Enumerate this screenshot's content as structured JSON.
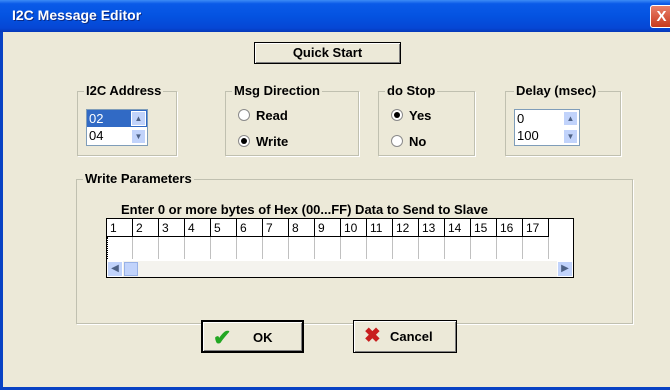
{
  "window": {
    "title": "I2C Message Editor",
    "close_glyph": "X"
  },
  "quick_start_label": "Quick Start",
  "i2c_address": {
    "legend": "I2C Address",
    "items": [
      "02",
      "04"
    ]
  },
  "msg_direction": {
    "legend": "Msg Direction",
    "options": [
      "Read",
      "Write"
    ],
    "selected": "Write"
  },
  "do_stop": {
    "legend": "do Stop",
    "options": [
      "Yes",
      "No"
    ],
    "selected": "Yes"
  },
  "delay": {
    "legend": "Delay (msec)",
    "items": [
      "0",
      "100"
    ]
  },
  "write_params": {
    "legend": "Write Parameters",
    "instruction": "Enter 0 or more bytes of Hex (00...FF) Data to Send to Slave",
    "columns": [
      "1",
      "2",
      "3",
      "4",
      "5",
      "6",
      "7",
      "8",
      "9",
      "10",
      "11",
      "12",
      "13",
      "14",
      "15",
      "16",
      "17"
    ]
  },
  "buttons": {
    "ok": "OK",
    "cancel": "Cancel"
  },
  "colors": {
    "title_bar": "#0453e1",
    "selection": "#316ac5",
    "dialog_bg": "#ece9d8",
    "ok_check": "#22a722",
    "cancel_x": "#c81e1e"
  },
  "icons": {
    "up": "up-arrow-icon",
    "down": "down-arrow-icon",
    "left": "left-arrow-icon",
    "right": "right-arrow-icon",
    "ok": "check-icon",
    "cancel": "x-icon"
  }
}
